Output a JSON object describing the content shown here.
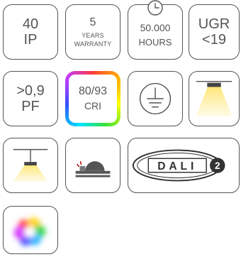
{
  "tiles": {
    "ip": {
      "value": "40",
      "label": "IP"
    },
    "warranty": {
      "value": "5",
      "line1": "YEARS",
      "line2": "WARRANTY"
    },
    "lifetime": {
      "value": "50.000",
      "label": "HOURS",
      "icon": "clock-icon"
    },
    "ugr": {
      "label": "UGR",
      "value": "<19"
    },
    "power_factor": {
      "value": ">0,9",
      "label": "PF"
    },
    "cri": {
      "value": "80/93",
      "label": "CRI"
    },
    "grounding": {
      "icon": "earth-ground-icon"
    },
    "ceiling_light": {
      "icon": "ceiling-lamp-icon"
    },
    "pendant_light": {
      "icon": "pendant-lamp-icon"
    },
    "saw": {
      "icon": "circular-saw-icon"
    },
    "dali": {
      "text": "DALI",
      "version": "2"
    },
    "rgb": {
      "icon": "color-spectrum-icon"
    }
  },
  "colors": {
    "stroke": "#555555",
    "light_yellow": "#fff2a8",
    "background": "#ffffff"
  }
}
